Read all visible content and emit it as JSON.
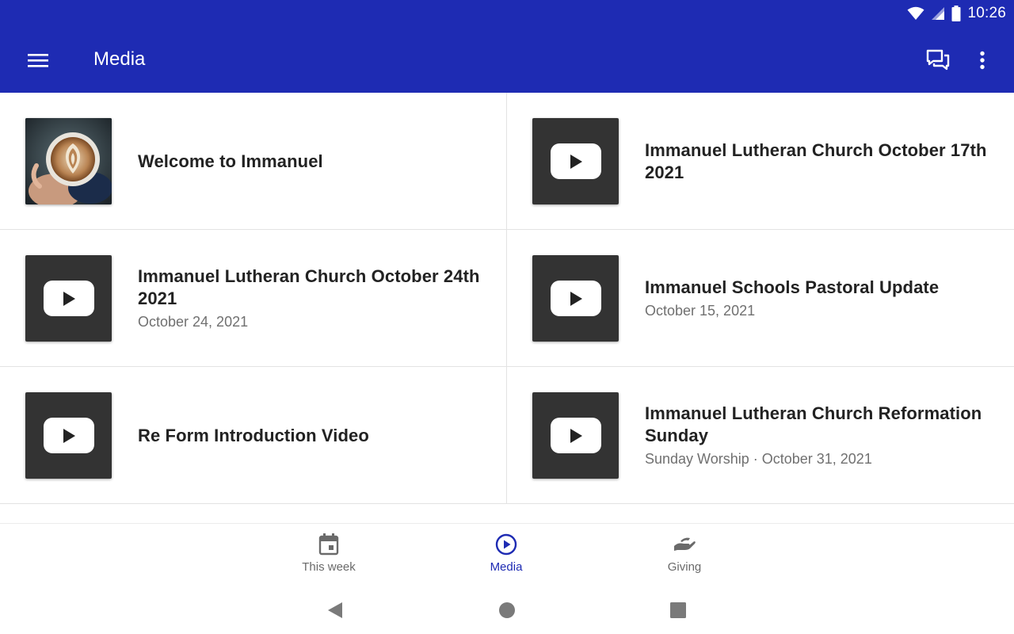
{
  "status_bar": {
    "time": "10:26"
  },
  "app_bar": {
    "title": "Media"
  },
  "media_items": [
    {
      "title": "Welcome to Immanuel",
      "subtitle": "",
      "thumbnail": "latte-art-photo"
    },
    {
      "title": "Immanuel Lutheran Church October 17th 2021",
      "subtitle": "",
      "thumbnail": "youtube-icon"
    },
    {
      "title": "Immanuel Lutheran Church October 24th 2021",
      "subtitle": "October 24, 2021",
      "thumbnail": "youtube-icon"
    },
    {
      "title": "Immanuel Schools Pastoral Update",
      "subtitle": "October 15, 2021",
      "thumbnail": "youtube-icon"
    },
    {
      "title": "Re Form Introduction Video",
      "subtitle": "",
      "thumbnail": "youtube-icon"
    },
    {
      "title": "Immanuel Lutheran Church Reformation Sunday",
      "subtitle": "Sunday Worship · October 31, 2021",
      "thumbnail": "youtube-icon"
    }
  ],
  "bottom_nav": [
    {
      "label": "This week",
      "icon": "calendar-icon",
      "active": false
    },
    {
      "label": "Media",
      "icon": "play-circle-icon",
      "active": true
    },
    {
      "label": "Giving",
      "icon": "giving-hand-icon",
      "active": false
    }
  ],
  "colors": {
    "primary": "#1e2bb3",
    "thumb_bg": "#333333",
    "inactive": "#6a6a6a"
  }
}
